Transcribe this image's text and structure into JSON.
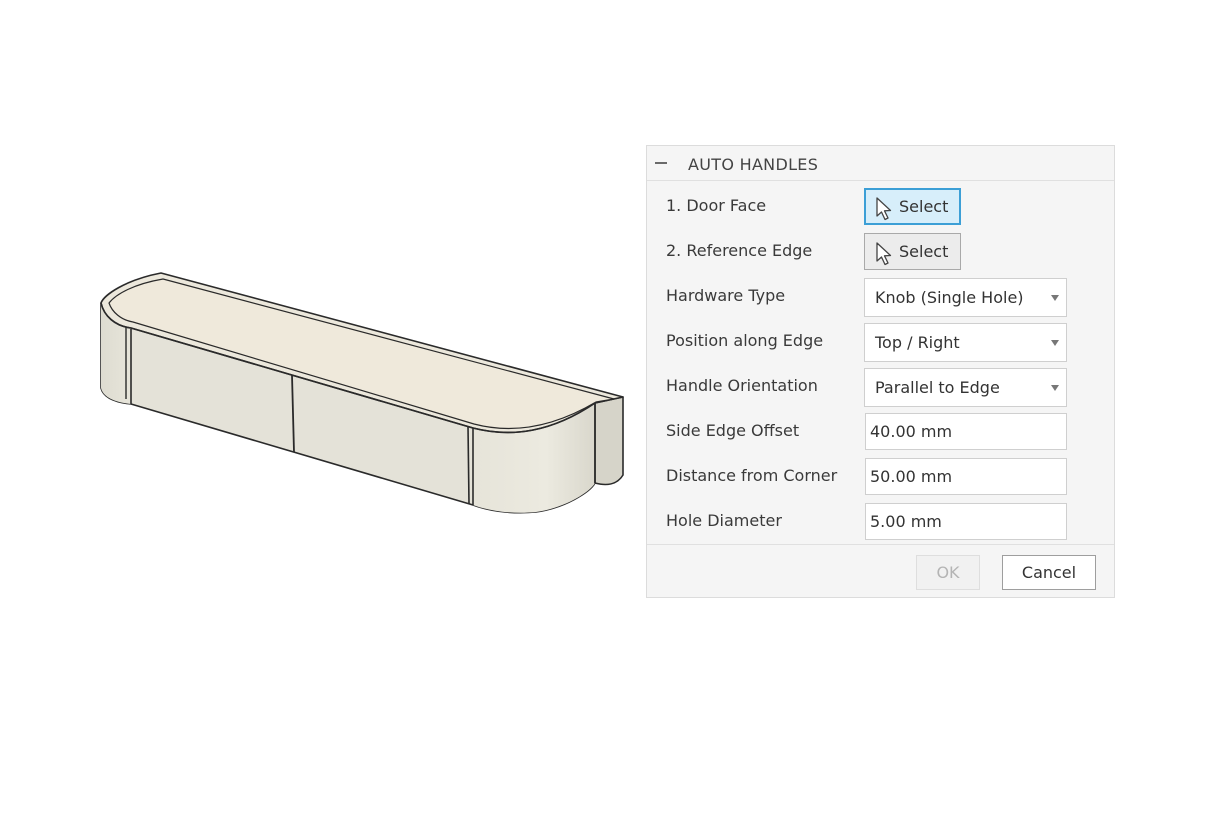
{
  "panel": {
    "title": "AUTO HANDLES",
    "rows": [
      {
        "label": "1. Door Face",
        "control": "select",
        "button_label": "Select",
        "active": true
      },
      {
        "label": "2. Reference Edge",
        "control": "select",
        "button_label": "Select",
        "active": false
      },
      {
        "label": "Hardware Type",
        "control": "dropdown",
        "value": "Knob (Single Hole)"
      },
      {
        "label": "Position along Edge",
        "control": "dropdown",
        "value": "Top / Right"
      },
      {
        "label": "Handle Orientation",
        "control": "dropdown",
        "value": "Parallel to Edge"
      },
      {
        "label": "Side Edge Offset",
        "control": "input",
        "value": "40.00 mm"
      },
      {
        "label": "Distance from Corner",
        "control": "input",
        "value": "50.00 mm"
      },
      {
        "label": "Hole Diameter",
        "control": "input",
        "value": "5.00 mm"
      }
    ],
    "ok_label": "OK",
    "cancel_label": "Cancel",
    "ok_enabled": false
  },
  "colors": {
    "accent": "#3c9fd6",
    "active_button_fill": "#d7eefa",
    "model_top": "#ece8dc",
    "model_side": "#e3e1d6"
  },
  "icons": [
    "collapse-icon",
    "cursor-arrow-icon",
    "chevron-down-icon"
  ]
}
